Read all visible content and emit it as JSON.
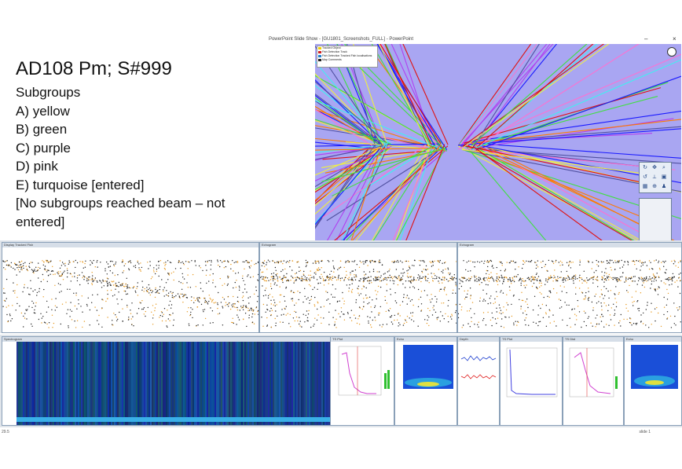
{
  "window": {
    "title": "PowerPoint Slide Show - [GU1801_Screenshots_FULL] - PowerPoint",
    "minimize": "–",
    "close": "×"
  },
  "slide": {
    "heading": "AD108 Pm; S#999",
    "lines": [
      "Subgroups",
      "A) yellow",
      "B) green",
      "C) purple",
      "D) pink",
      "E) turquoise [entered]",
      "[No subgroups reached beam – not",
      "entered]"
    ]
  },
  "radar": {
    "background": "#a9a6f2",
    "legend": [
      {
        "label": "Tracked Object",
        "color": "#f0d000"
      },
      {
        "label": "Fish Detection Track",
        "color": "#d02020"
      },
      {
        "label": "Fish Detection Tracked Fish localisations",
        "color": "#2080d0"
      },
      {
        "label": "Map Comments",
        "color": "#202020"
      }
    ],
    "track_colors": [
      "#1a1aff",
      "#e01010",
      "#f0f040",
      "#40e040",
      "#b040f0",
      "#ff70d0",
      "#40f0f0",
      "#ff7a00",
      "#5050a0"
    ]
  },
  "panels": [
    {
      "title": "Display Tracked Fish"
    },
    {
      "title": "Echogram"
    },
    {
      "title": "Echogram"
    }
  ],
  "bottom": {
    "spectrogram_title": "Spectrogram",
    "minis": [
      {
        "title": "TS Plot"
      },
      {
        "title": "Echo"
      },
      {
        "title": "Depth"
      },
      {
        "title": "TS Plot"
      },
      {
        "title": "TS Dist"
      },
      {
        "title": "Echo"
      }
    ]
  },
  "status": {
    "left": "29.5",
    "right": "slide 1"
  }
}
